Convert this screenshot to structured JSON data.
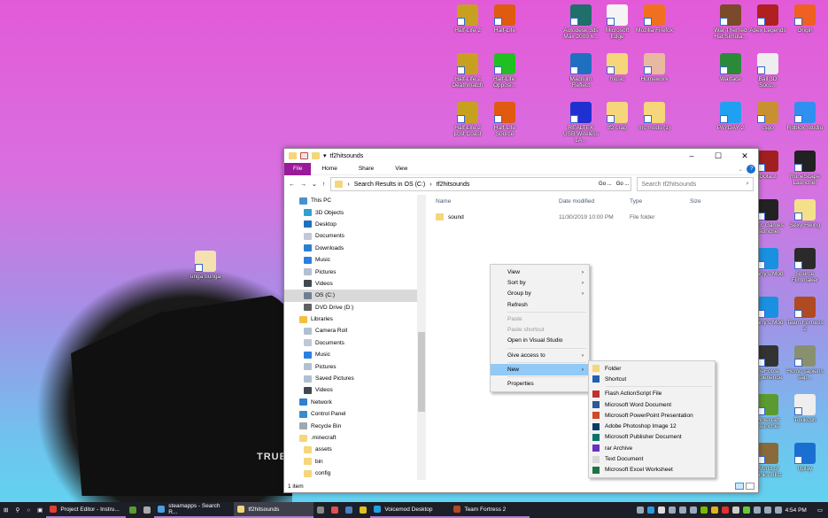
{
  "desktop": {
    "icons": [
      {
        "label": "Half-Life 2",
        "color": "#c8a020",
        "col": 528,
        "row": 5
      },
      {
        "label": "Half-Life",
        "color": "#e05a10",
        "col": 570,
        "row": 5
      },
      {
        "label": "Autodesk 3ds Max 2009 6...",
        "color": "#1f6f6a",
        "col": 656,
        "row": 5
      },
      {
        "label": "Microsoft Edge",
        "color": "#f4f4f4",
        "col": 697,
        "row": 5
      },
      {
        "label": "Mozilla Firefox",
        "color": "#f07020",
        "col": 739,
        "row": 5
      },
      {
        "label": "War Themed Hat Simula...",
        "color": "#7a4a2a",
        "col": 825,
        "row": 5
      },
      {
        "label": "Apex Legends",
        "color": "#b02020",
        "col": 867,
        "row": 5
      },
      {
        "label": "Origin",
        "color": "#f06020",
        "col": 909,
        "row": 5
      },
      {
        "label": "Half-Life 2 Deathmatch",
        "color": "#c8a020",
        "col": 528,
        "row": 60
      },
      {
        "label": "Half-Life: Opposi...",
        "color": "#20c020",
        "col": 570,
        "row": 60
      },
      {
        "label": "Macrium Reflect",
        "color": "#2070c0",
        "col": 656,
        "row": 60
      },
      {
        "label": "music",
        "color": "#f5d67a",
        "col": 697,
        "row": 60
      },
      {
        "label": "Homework",
        "color": "#e8b8a0",
        "col": 739,
        "row": 60
      },
      {
        "label": "Warface",
        "color": "#2a8a3a",
        "col": 825,
        "row": 60
      },
      {
        "label": "Ball 3D Socc...",
        "color": "#eeeeee",
        "col": 867,
        "row": 60
      },
      {
        "label": "Half-Life 2 Lost Coast",
        "color": "#c8a020",
        "col": 528,
        "row": 115
      },
      {
        "label": "Half-Life Source",
        "color": "#e05a10",
        "col": 570,
        "row": 115
      },
      {
        "label": "REALTEK USB Wireless LA...",
        "color": "#2030d0",
        "col": 656,
        "row": 115
      },
      {
        "label": "tf2 crap",
        "color": "#f5d67a",
        "col": 697,
        "row": 115
      },
      {
        "label": "mc mods (1)",
        "color": "#f5d67a",
        "col": 739,
        "row": 115
      },
      {
        "label": "PAYDAY 2",
        "color": "#20a0f0",
        "col": 825,
        "row": 115
      },
      {
        "label": "csgo",
        "color": "#c89030",
        "col": 867,
        "row": 115
      },
      {
        "label": "Roblox Studio",
        "color": "#3090f0",
        "col": 909,
        "row": 115
      },
      {
        "label": "Dota 2",
        "color": "#a02020",
        "col": 867,
        "row": 170
      },
      {
        "label": "RuneScape Launcher",
        "color": "#222222",
        "col": 909,
        "row": 170
      },
      {
        "label": "Epic Games Launcher",
        "color": "#222222",
        "col": 867,
        "row": 225
      },
      {
        "label": "Sexy Hiking",
        "color": "#f5e08a",
        "col": 909,
        "row": 225
      },
      {
        "label": "Garry's Mod",
        "color": "#1a90e0",
        "col": 867,
        "row": 280
      },
      {
        "label": "Source Filmmaker",
        "color": "#2a2a2a",
        "col": 909,
        "row": 280
      },
      {
        "label": "Garry's Mod",
        "color": "#1a90e0",
        "col": 867,
        "row": 335
      },
      {
        "label": "Team Fortress 2",
        "color": "#b04a20",
        "col": 909,
        "row": 335
      },
      {
        "label": "GeForce Experience",
        "color": "#333333",
        "col": 867,
        "row": 390
      },
      {
        "label": "Homo sapiens sap...",
        "color": "#889070",
        "col": 909,
        "row": 390
      },
      {
        "label": "Minecraft Launcher",
        "color": "#5a9a30",
        "col": 867,
        "row": 445
      },
      {
        "label": "Toxikosh",
        "color": "#eeeeee",
        "col": 909,
        "row": 445
      },
      {
        "label": "World of Tanks Blitz",
        "color": "#8a6a3a",
        "col": 867,
        "row": 500
      },
      {
        "label": "Uplay",
        "color": "#1a70d0",
        "col": 909,
        "row": 500
      },
      {
        "label": "unga bunga",
        "color": "#f5e0b0",
        "col": 232,
        "row": 283
      }
    ],
    "wallpaper_text": "TRUENO"
  },
  "explorer": {
    "title": "tf2hitsounds",
    "ribbon": [
      "File",
      "Home",
      "Share",
      "View"
    ],
    "breadcrumb": [
      "Search Results in OS (C:)",
      "tf2hitsounds"
    ],
    "go_labels": [
      "Go ...",
      "Go ..."
    ],
    "search_placeholder": "Search tf2hitsounds",
    "nav": [
      {
        "label": "This PC",
        "level": 0,
        "color": "#4a90d0"
      },
      {
        "label": "3D Objects",
        "level": 1,
        "color": "#30a0d0"
      },
      {
        "label": "Desktop",
        "level": 1,
        "color": "#2070c0"
      },
      {
        "label": "Documents",
        "level": 1,
        "color": "#c0c8d8"
      },
      {
        "label": "Downloads",
        "level": 1,
        "color": "#2a80d0"
      },
      {
        "label": "Music",
        "level": 1,
        "color": "#2a80e0"
      },
      {
        "label": "Pictures",
        "level": 1,
        "color": "#b0c0d0"
      },
      {
        "label": "Videos",
        "level": 1,
        "color": "#404850"
      },
      {
        "label": "OS (C:)",
        "level": 1,
        "color": "#708090",
        "selected": true
      },
      {
        "label": "DVD Drive (D:)",
        "level": 1,
        "color": "#606060"
      },
      {
        "label": "Libraries",
        "level": 0,
        "color": "#f0c040"
      },
      {
        "label": "Camera Roll",
        "level": 1,
        "color": "#b0c0d0"
      },
      {
        "label": "Documents",
        "level": 1,
        "color": "#c0c8d8"
      },
      {
        "label": "Music",
        "level": 1,
        "color": "#2a80e0"
      },
      {
        "label": "Pictures",
        "level": 1,
        "color": "#b0c0d0"
      },
      {
        "label": "Saved Pictures",
        "level": 1,
        "color": "#b0c0d0"
      },
      {
        "label": "Videos",
        "level": 1,
        "color": "#404850"
      },
      {
        "label": "Network",
        "level": 0,
        "color": "#3080d0"
      },
      {
        "label": "Control Panel",
        "level": 0,
        "color": "#3a8ad0"
      },
      {
        "label": "Recycle Bin",
        "level": 0,
        "color": "#a0a8b0"
      },
      {
        "label": ".minecraft",
        "level": 0,
        "color": "#f5d67a"
      },
      {
        "label": "assets",
        "level": 1,
        "color": "#f5d67a"
      },
      {
        "label": "bin",
        "level": 1,
        "color": "#f5d67a"
      },
      {
        "label": "config",
        "level": 1,
        "color": "#f5d67a"
      }
    ],
    "columns": [
      "Name",
      "Date modified",
      "Type",
      "Size"
    ],
    "files": [
      {
        "name": "sound",
        "date": "11/30/2019 10:00 PM",
        "type": "File folder",
        "size": ""
      }
    ],
    "status": "1 item"
  },
  "context_menu": {
    "items": [
      {
        "label": "View",
        "submenu": true
      },
      {
        "label": "Sort by",
        "submenu": true
      },
      {
        "label": "Group by",
        "submenu": true
      },
      {
        "label": "Refresh"
      },
      {
        "sep": true
      },
      {
        "label": "Paste",
        "disabled": true
      },
      {
        "label": "Paste shortcut",
        "disabled": true
      },
      {
        "label": "Open in Visual Studio"
      },
      {
        "sep": true
      },
      {
        "label": "Give access to",
        "submenu": true
      },
      {
        "sep": true
      },
      {
        "label": "New",
        "submenu": true,
        "highlighted": true
      },
      {
        "sep": true
      },
      {
        "label": "Properties"
      }
    ],
    "new_submenu": [
      {
        "label": "Folder",
        "color": "#f5d67a"
      },
      {
        "label": "Shortcut",
        "color": "#2060b0"
      },
      {
        "sep": true
      },
      {
        "label": "Flash ActionScript File",
        "color": "#c03030"
      },
      {
        "label": "Microsoft Word Document",
        "color": "#2b579a"
      },
      {
        "label": "Microsoft PowerPoint Presentation",
        "color": "#d24726"
      },
      {
        "label": "Adobe Photoshop Image 12",
        "color": "#0a3a6a"
      },
      {
        "label": "Microsoft Publisher Document",
        "color": "#077568"
      },
      {
        "label": "rar Archive",
        "color": "#6a30c0"
      },
      {
        "label": "Text Document",
        "color": "#d8d8d8"
      },
      {
        "label": "Microsoft Excel Worksheet",
        "color": "#217346"
      }
    ]
  },
  "taskbar": {
    "apps": [
      {
        "label": "Project Editor - Instru...",
        "color": "#e04030"
      },
      {
        "label": "",
        "color": "#5a9a30"
      },
      {
        "label": "",
        "color": "#aaaaaa"
      },
      {
        "label": "steamapps - Search R...",
        "color": "#4aa0e0"
      },
      {
        "label": "tf2hitsounds",
        "color": "#f5d67a",
        "active": true
      },
      {
        "label": "",
        "color": "#888888"
      },
      {
        "label": "",
        "color": "#e05050"
      },
      {
        "label": "",
        "color": "#4a80c0"
      },
      {
        "label": "",
        "color": "#e0c020"
      },
      {
        "label": "Voicemod Desktop",
        "color": "#20a0e0"
      },
      {
        "label": "Team Fortress 2",
        "color": "#b04a20"
      }
    ],
    "clock": "4:54 PM"
  }
}
